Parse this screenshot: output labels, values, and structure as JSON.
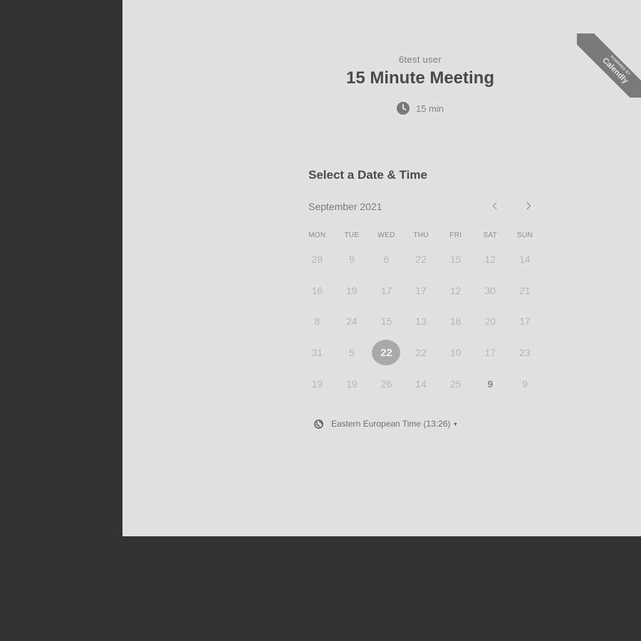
{
  "badge": {
    "powered_by": "POWERED BY",
    "brand": "Calendly"
  },
  "event": {
    "owner": "6test user",
    "title": "15 Minute Meeting",
    "duration": "15 min"
  },
  "calendar": {
    "heading": "Select a Date & Time",
    "month": "September 2021",
    "prev_icon": "chevron-left-icon",
    "next_icon": "chevron-right-icon",
    "weekdays": [
      "MON",
      "TUE",
      "WED",
      "THU",
      "FRI",
      "SAT",
      "SUN"
    ],
    "weeks": [
      [
        "28",
        "9",
        "6",
        "22",
        "15",
        "12",
        "14"
      ],
      [
        "16",
        "19",
        "17",
        "17",
        "12",
        "30",
        "21"
      ],
      [
        "8",
        "24",
        "15",
        "13",
        "18",
        "20",
        "17"
      ],
      [
        "31",
        "5",
        "22",
        "22",
        "10",
        "17",
        "23"
      ],
      [
        "19",
        "19",
        "26",
        "14",
        "25",
        "9",
        "9"
      ]
    ],
    "selected": {
      "week": 3,
      "day": 2
    },
    "emphasized": [
      {
        "week": 4,
        "day": 5
      }
    ]
  },
  "timezone": {
    "icon": "globe-icon",
    "label": "Eastern European Time (13:26)",
    "caret": "▾"
  },
  "colors": {
    "background": "#333333",
    "panel": "#e1e1e1",
    "selected_day": "#a9a9a9"
  }
}
